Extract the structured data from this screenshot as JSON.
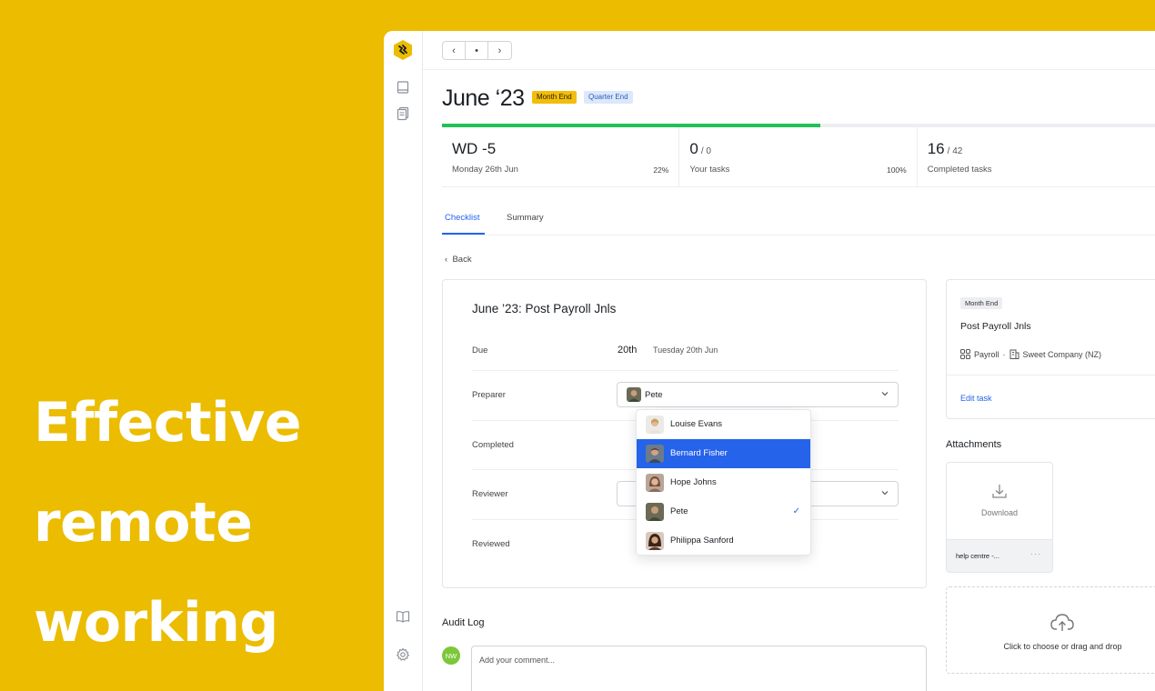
{
  "hero": {
    "lines": [
      "Effective",
      "remote",
      "working"
    ]
  },
  "topbar": {
    "prev": "‹",
    "dot": "•",
    "next": "›"
  },
  "header": {
    "title": "June ‘23",
    "badges": [
      "Month End",
      "Quarter End"
    ]
  },
  "progress": {
    "fraction": 0.53,
    "color": "#22c05a"
  },
  "stats": [
    {
      "value": "WD -5",
      "suffix": "",
      "label": "Monday 26th Jun",
      "pct": "22%"
    },
    {
      "value": "0",
      "suffix": "/ 0",
      "label": "Your tasks",
      "pct": "100%"
    },
    {
      "value": "16",
      "suffix": "/ 42",
      "label": "Completed tasks",
      "pct": ""
    }
  ],
  "tabs": [
    {
      "label": "Checklist",
      "active": true
    },
    {
      "label": "Summary",
      "active": false
    }
  ],
  "back_label": "Back",
  "task": {
    "title": "June ’23: Post Payroll Jnls",
    "fields": {
      "due_label": "Due",
      "due_day": "20th",
      "due_date": "Tuesday 20th Jun",
      "preparer_label": "Preparer",
      "preparer_value": "Pete",
      "completed_label": "Completed",
      "reviewer_label": "Reviewer",
      "reviewed_label": "Reviewed"
    }
  },
  "dropdown": {
    "options": [
      {
        "name": "Louise Evans",
        "selected": false,
        "checked": false
      },
      {
        "name": "Bernard Fisher",
        "selected": true,
        "checked": false
      },
      {
        "name": "Hope Johns",
        "selected": false,
        "checked": false
      },
      {
        "name": "Pete",
        "selected": false,
        "checked": true
      },
      {
        "name": "Philippa Sanford",
        "selected": false,
        "checked": false
      }
    ]
  },
  "audit": {
    "title": "Audit Log",
    "initials": "NW",
    "placeholder": "Add your comment..."
  },
  "side": {
    "badge": "Month End",
    "title": "Post Payroll Jnls",
    "category": "Payroll",
    "separator": "·",
    "company": "Sweet Company (NZ)",
    "edit": "Edit task"
  },
  "attachments": {
    "title": "Attachments",
    "download": "Download",
    "file_name": "help centre -...",
    "more": "···",
    "upload_text": "Click to choose or drag and drop"
  },
  "colors": {
    "brand": "#EBBC00",
    "accent": "#2563eb",
    "success": "#22c05a"
  },
  "icons": {
    "rail": [
      "logo-icon",
      "book-icon",
      "documents-icon",
      "open-book-icon",
      "gear-icon"
    ],
    "chevron": "chevron-down-icon",
    "check": "✓"
  }
}
